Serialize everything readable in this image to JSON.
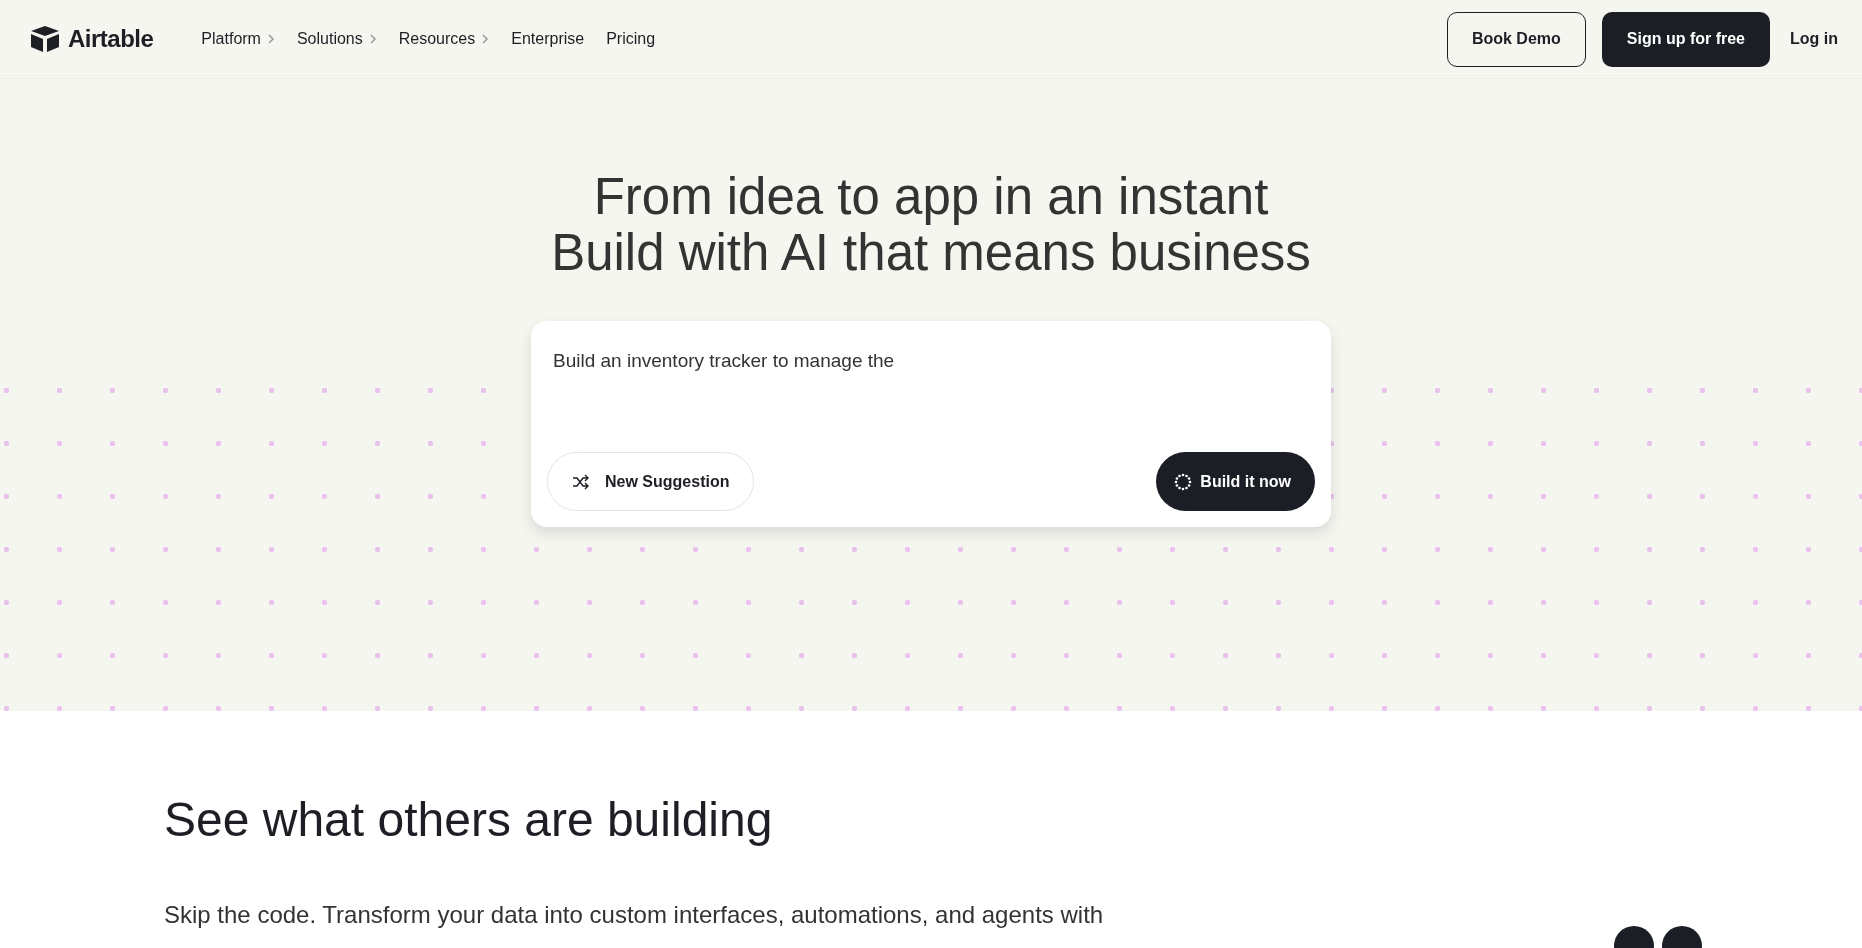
{
  "header": {
    "logo": "Airtable",
    "nav": [
      {
        "label": "Platform",
        "has_submenu": true
      },
      {
        "label": "Solutions",
        "has_submenu": true
      },
      {
        "label": "Resources",
        "has_submenu": true
      },
      {
        "label": "Enterprise",
        "has_submenu": false
      },
      {
        "label": "Pricing",
        "has_submenu": false
      }
    ],
    "actions": [
      {
        "label": "Book Demo",
        "kind": "outline"
      },
      {
        "label": "Sign up for free",
        "kind": "solid"
      },
      {
        "label": "Log in",
        "kind": "link"
      }
    ]
  },
  "hero": {
    "title_lines": [
      "From idea to app in an instant",
      "Build with AI that means business"
    ],
    "prompt": {
      "value": "Build an inventory tracker to manage the",
      "suggestion_button": "New Suggestion",
      "build_button": "Build it now"
    }
  },
  "section": {
    "heading": "See what others are building",
    "text": "Skip the code. Transform your data into custom interfaces, automations, and agents with"
  }
}
